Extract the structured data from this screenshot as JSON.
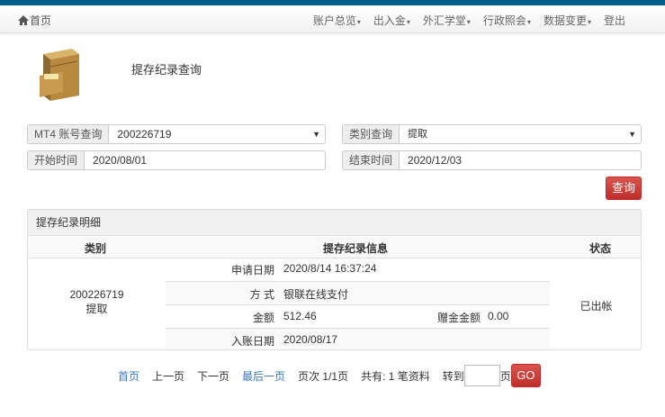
{
  "nav": {
    "home": "首页",
    "menu": [
      "账户总览",
      "出入金",
      "外汇学堂",
      "行政照会",
      "数据变更"
    ],
    "logout": "登出"
  },
  "page_title": "提存纪录查询",
  "form": {
    "account_label": "MT4 账号查询",
    "account_value": "200226719",
    "type_label": "类别查询",
    "type_value": "提取",
    "start_label": "开始时间",
    "start_value": "2020/08/01",
    "end_label": "结束时间",
    "end_value": "2020/12/03",
    "query_button": "查询"
  },
  "panel": {
    "title": "提存纪录明细",
    "headers": {
      "type": "类别",
      "info": "提存纪录信息",
      "status": "状态"
    },
    "record": {
      "account": "200226719",
      "type": "提取",
      "status": "已出帐",
      "apply_label": "申请日期",
      "apply_value": "2020/8/14 16:37:24",
      "method_label": "方 式",
      "method_value": "银联在线支付",
      "amount_label": "金额",
      "amount_value": "512.46",
      "bonus_label": "赠金金额",
      "bonus_value": "0.00",
      "post_label": "入账日期",
      "post_value": "2020/08/17"
    }
  },
  "pager": {
    "first": "首页",
    "prev": "上一页",
    "next": "下一页",
    "last": "最后一页",
    "page_info": "页次 1/1页",
    "total": "共有: 1 笔资料",
    "goto": "转到",
    "page_unit": "页",
    "go": "GO"
  }
}
